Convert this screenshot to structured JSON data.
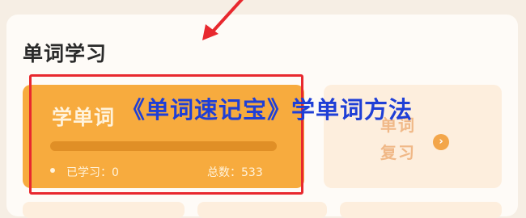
{
  "section": {
    "title": "单词学习"
  },
  "learn_card": {
    "title": "学单词",
    "progress_fraction": 0,
    "learned_label": "已学习：0",
    "total_label": "总数：533"
  },
  "review_card": {
    "label_line1": "单词",
    "label_line2": "复习",
    "arrow_glyph": "›"
  },
  "overlay": {
    "title": "《单词速记宝》学单词方法"
  },
  "colors": {
    "accent_orange": "#f7ab3e",
    "highlight_red": "#e8282e",
    "overlay_blue": "#1f3fd6"
  }
}
